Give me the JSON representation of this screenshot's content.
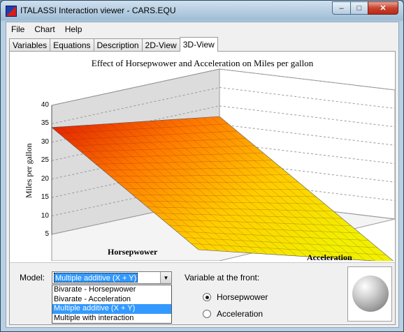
{
  "window": {
    "title": "ITALASSI Interaction viewer - CARS.EQU",
    "controls": {
      "minimize": "–",
      "maximize": "□",
      "close": "✕"
    }
  },
  "menu": {
    "items": [
      "File",
      "Chart",
      "Help"
    ]
  },
  "tabs": [
    {
      "label": "Variables",
      "active": false
    },
    {
      "label": "Equations",
      "active": false
    },
    {
      "label": "Description",
      "active": false
    },
    {
      "label": "2D-View",
      "active": false
    },
    {
      "label": "3D-View",
      "active": true
    }
  ],
  "chart_data": {
    "type": "surface3d",
    "title": "Effect of Horsepwower and Acceleration on Miles per gallon",
    "ylabel": "Miles per gallon",
    "xlabel": "Horsepwower",
    "zlabel": "Acceleration",
    "yticks": [
      5,
      10,
      15,
      20,
      25,
      30,
      35,
      40
    ],
    "ylim": [
      5,
      40
    ],
    "surface_range": [
      5,
      34
    ],
    "colormap": [
      "#e01a00",
      "#ff7a00",
      "#ffcc00",
      "#f0f000"
    ],
    "grid": true
  },
  "controls": {
    "model_label": "Model:",
    "model_value": "Multiple additive (X + Y)",
    "model_options": [
      "Bivarate - Horsepwower",
      "Bivarate - Acceleration",
      "Multiple additive (X + Y)",
      "Multiple with interaction"
    ],
    "model_selected_index": 2,
    "front_label": "Variable at the front:",
    "front_options": [
      "Horsepwower",
      "Acceleration"
    ],
    "front_selected_index": 0
  }
}
